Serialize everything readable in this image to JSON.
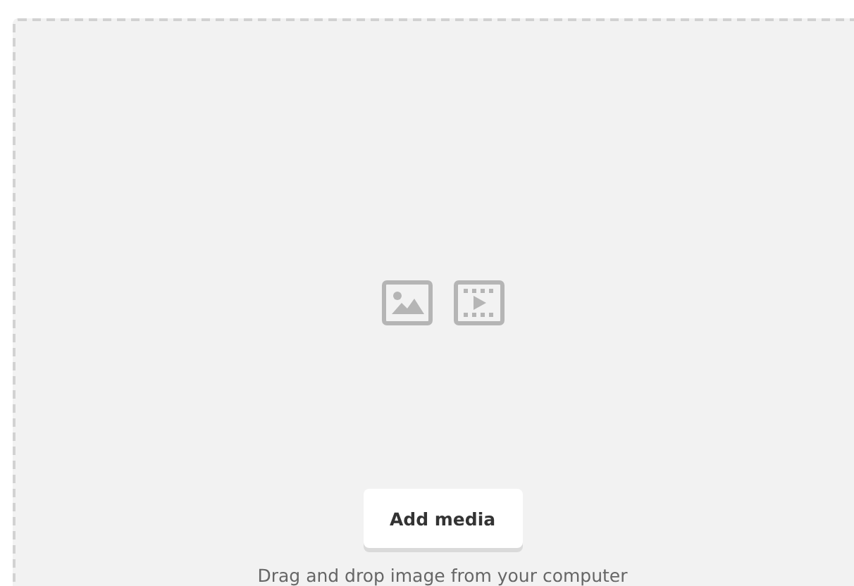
{
  "dropzone": {
    "button": "Add media",
    "hint": "Drag and drop image from your computer"
  }
}
